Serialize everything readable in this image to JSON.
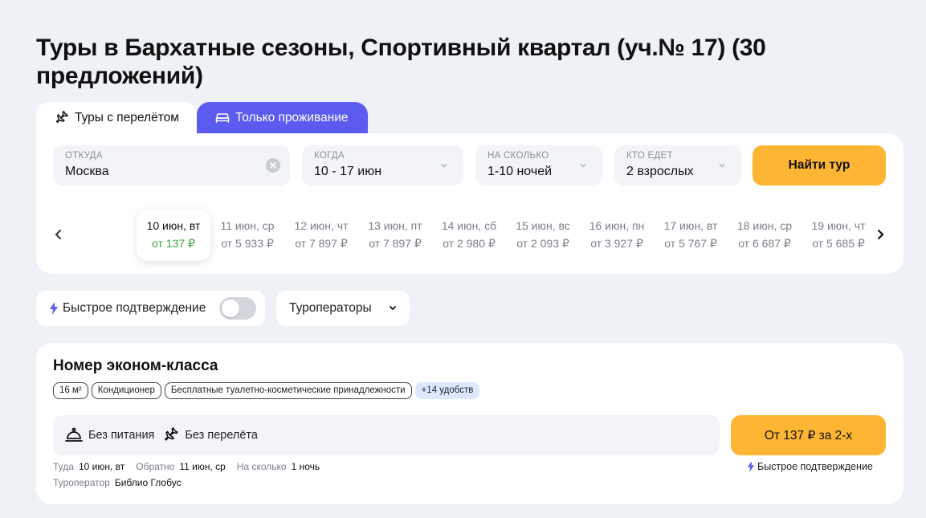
{
  "page": {
    "title": "Туры в Бархатные сезоны, Спортивный квартал (уч.№ 17) (30 предложений)"
  },
  "tabs": {
    "flight": "Туры с перелётом",
    "stay": "Только проживание"
  },
  "search": {
    "from": {
      "label": "ОТКУДА",
      "value": "Москва"
    },
    "when": {
      "label": "КОГДА",
      "value": "10 - 17 июн"
    },
    "nights": {
      "label": "НА СКОЛЬКО",
      "value": "1-10 ночей"
    },
    "who": {
      "label": "КТО ЕДЕТ",
      "value": "2 взрослых"
    },
    "find_button": "Найти тур"
  },
  "dates": [
    {
      "date": "10 июн, вт",
      "price": "от 137 ₽",
      "active": true
    },
    {
      "date": "11 июн, ср",
      "price": "от 5 933 ₽",
      "active": false
    },
    {
      "date": "12 июн, чт",
      "price": "от 7 897 ₽",
      "active": false
    },
    {
      "date": "13 июн, пт",
      "price": "от 7 897 ₽",
      "active": false
    },
    {
      "date": "14 июн, сб",
      "price": "от 2 980 ₽",
      "active": false
    },
    {
      "date": "15 июн, вс",
      "price": "от 2 093 ₽",
      "active": false
    },
    {
      "date": "16 июн, пн",
      "price": "от 3 927 ₽",
      "active": false
    },
    {
      "date": "17 июн, вт",
      "price": "от 5 767 ₽",
      "active": false
    },
    {
      "date": "18 июн, ср",
      "price": "от 6 687 ₽",
      "active": false
    },
    {
      "date": "19 июн, чт",
      "price": "от 5 685 ₽",
      "active": false
    }
  ],
  "filters": {
    "quick_confirm": "Быстрое подтверждение",
    "quick_confirm_on": false,
    "operators": "Туроператоры"
  },
  "room": {
    "title": "Номер эконом-класса",
    "chips": [
      "16 м²",
      "Кондиционер",
      "Бесплатные туалетно-косметические принадлежности"
    ],
    "more_chip": "+14 удобств",
    "meal": "Без питания",
    "flight": "Без перелёта",
    "price_button": "От 137 ₽ за 2-х",
    "quick_note": "Быстрое подтверждение",
    "there_label": "Туда",
    "there_value": "10 июн, вт",
    "back_label": "Обратно",
    "back_value": "11 июн, ср",
    "duration_label": "На сколько",
    "duration_value": "1 ночь",
    "operator_label": "Туроператор",
    "operator_value": "Библио Глобус"
  },
  "colors": {
    "accent": "#5b5bf0",
    "button": "#ffb534",
    "price_active": "#3aa83a",
    "background": "#eef1f6"
  }
}
